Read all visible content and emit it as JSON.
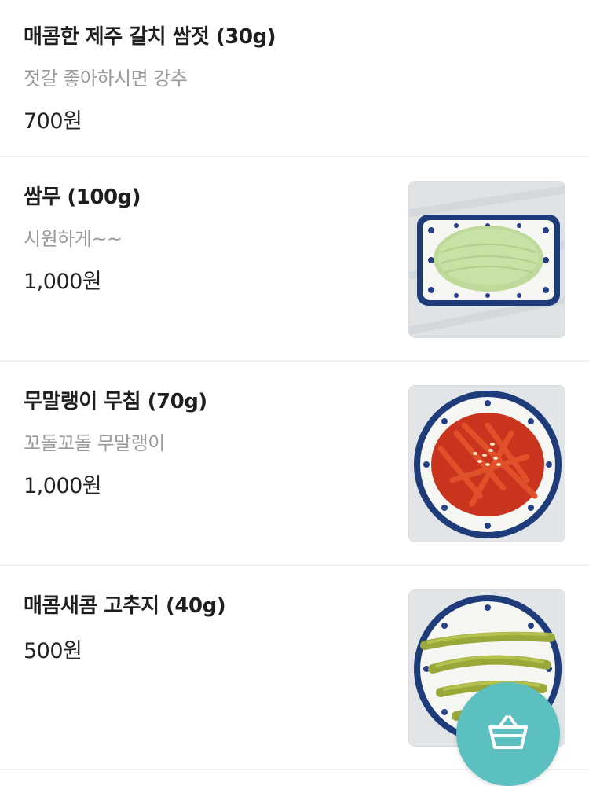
{
  "menu": {
    "items": [
      {
        "name": "매콤한 제주 갈치 쌈젓 (30g)",
        "description": "젓갈 좋아하시면 강추",
        "price": "700원"
      },
      {
        "name": "쌈무 (100g)",
        "description": "시원하게~~",
        "price": "1,000원",
        "photo_icon": "pickled-radish-plate-photo"
      },
      {
        "name": "무말랭이 무침 (70g)",
        "description": "꼬돌꼬돌 무말랭이",
        "price": "1,000원",
        "photo_icon": "dried-radish-plate-photo"
      },
      {
        "name": "매콤새콤 고추지 (40g)",
        "price": "500원",
        "photo_icon": "pickled-pepper-plate-photo"
      }
    ]
  },
  "cart_button": {
    "icon": "basket-icon",
    "color": "#5cbfc0"
  }
}
